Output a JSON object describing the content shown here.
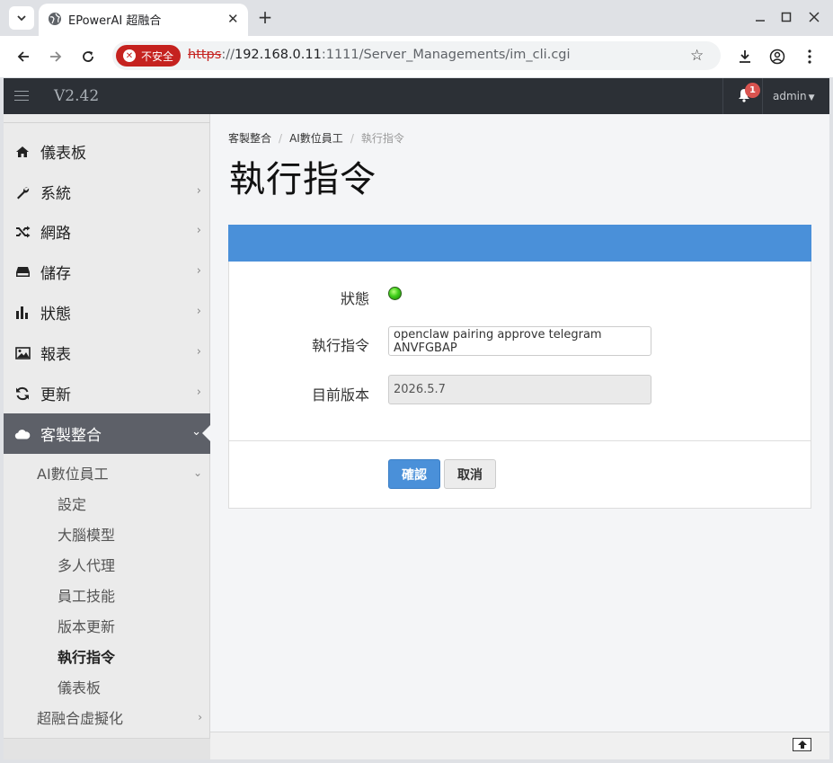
{
  "browser": {
    "tab_title": "EPowerAI 超融合",
    "new_tab": "+",
    "security_label": "不安全",
    "url": {
      "scheme": "https",
      "sep": "://",
      "host": "192.168.0.11",
      "rest": ":1111/Server_Managements/im_cli.cgi"
    }
  },
  "header": {
    "version": "V2.42",
    "notification_count": "1",
    "user": "admin"
  },
  "sidebar": {
    "items": [
      {
        "label": "儀表板",
        "icon": "home-icon"
      },
      {
        "label": "系統",
        "icon": "wrench-icon"
      },
      {
        "label": "網路",
        "icon": "shuffle-icon"
      },
      {
        "label": "儲存",
        "icon": "hdd-icon"
      },
      {
        "label": "狀態",
        "icon": "bar-chart-icon"
      },
      {
        "label": "報表",
        "icon": "image-icon"
      },
      {
        "label": "更新",
        "icon": "refresh-icon"
      },
      {
        "label": "客製整合",
        "icon": "cloud-icon"
      }
    ],
    "sub": {
      "ai_employee": "AI數位員工",
      "children": [
        "設定",
        "大腦模型",
        "多人代理",
        "員工技能",
        "版本更新",
        "執行指令",
        "儀表板"
      ],
      "hci": "超融合虛擬化"
    }
  },
  "breadcrumb": [
    "客製整合",
    "AI數位員工",
    "執行指令"
  ],
  "page_title": "執行指令",
  "form": {
    "status_label": "狀態",
    "status_color": "#3fcf1a",
    "command_label": "執行指令",
    "command_value": "openclaw pairing approve telegram ANVFGBAP",
    "version_label": "目前版本",
    "version_value": "2026.5.7",
    "confirm_label": "確認",
    "cancel_label": "取消"
  },
  "colors": {
    "accent": "#4a90d9",
    "header_bg": "#2c3036",
    "active_nav_bg": "#5d6068"
  }
}
